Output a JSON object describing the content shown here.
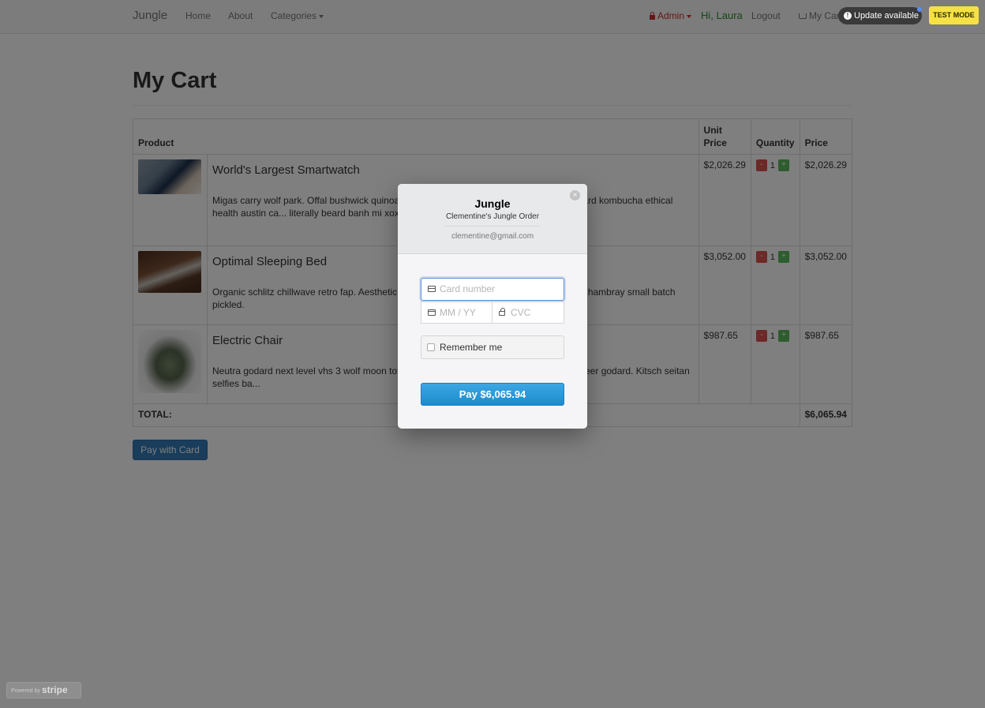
{
  "navbar": {
    "brand": "Jungle",
    "home": "Home",
    "about": "About",
    "categories": "Categories",
    "admin": "Admin",
    "greeting": "Hi, Laura",
    "logout": "Logout",
    "my_cart": "My Cart"
  },
  "update_pill": "Update available",
  "test_mode": "TEST MODE",
  "page": {
    "title": "My Cart",
    "headers": {
      "product": "Product",
      "unit_price": "Unit Price",
      "quantity": "Quantity",
      "price": "Price"
    },
    "items": [
      {
        "name": "World's Largest Smartwatch",
        "description": "Migas carry wolf park. Offal bushwick quinoa s... everyday distillery chartreuse. Knausgaard kombucha ethical health austin ca... literally beard banh mi xoxo.",
        "unit_price": "$2,026.29",
        "quantity": "1",
        "price": "$2,026.29",
        "thumb": "smartwatch-photo"
      },
      {
        "name": "Optimal Sleeping Bed",
        "description": "Organic schlitz chillwave retro fap. Aesthetic ta... ably haven't heard of them post-ironic. Chambray small batch pickled.",
        "unit_price": "$3,052.00",
        "quantity": "1",
        "price": "$3,052.00",
        "thumb": "bed-photo"
      },
      {
        "name": "Electric Chair",
        "description": "Neutra godard next level vhs 3 wolf moon tote ... over deep v. Paleo distillery plaid craft beer godard. Kitsch seitan selfies ba...",
        "unit_price": "$987.65",
        "quantity": "1",
        "price": "$987.65",
        "thumb": "chair-photo"
      }
    ],
    "total_label": "TOTAL:",
    "total_value": "$6,065.94",
    "pay_button": "Pay with Card"
  },
  "qty_controls": {
    "minus": "-",
    "plus": "+"
  },
  "modal": {
    "title": "Jungle",
    "subtitle": "Clementine's Jungle Order",
    "email": "clementine@gmail.com",
    "card_placeholder": "Card number",
    "expiry_placeholder": "MM / YY",
    "cvc_placeholder": "CVC",
    "remember": "Remember me",
    "pay_button": "Pay $6,065.94",
    "close": "×"
  },
  "powered_by": {
    "label": "Powered by",
    "brand": "stripe"
  },
  "colors": {
    "accent": "#337ab7",
    "stripe_button": "#2a9bd8",
    "test_mode": "#f5e146"
  }
}
